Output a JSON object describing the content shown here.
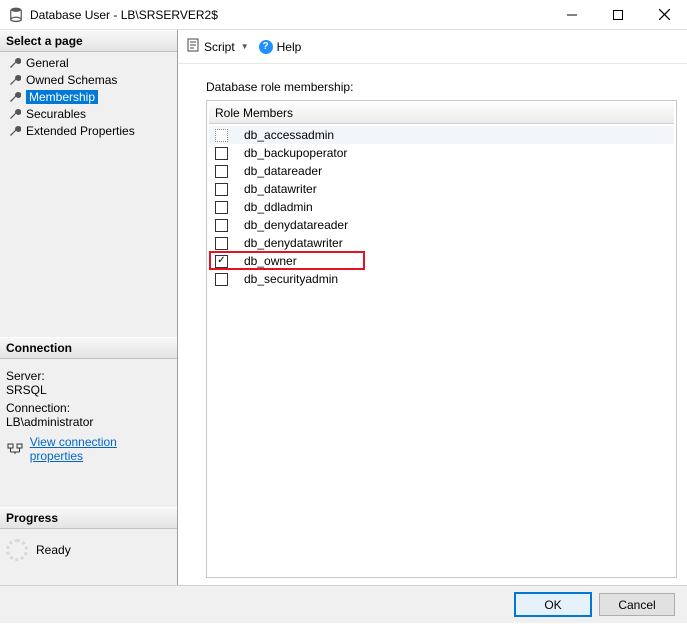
{
  "window": {
    "title": "Database User - LB\\SRSERVER2$"
  },
  "sidebar": {
    "select_page_header": "Select a page",
    "pages": [
      {
        "label": "General"
      },
      {
        "label": "Owned Schemas"
      },
      {
        "label": "Membership"
      },
      {
        "label": "Securables"
      },
      {
        "label": "Extended Properties"
      }
    ],
    "selected_index": 2,
    "connection_header": "Connection",
    "server_label": "Server:",
    "server_value": "SRSQL",
    "connection_label": "Connection:",
    "connection_value": "LB\\administrator",
    "view_conn_props": "View connection properties",
    "progress_header": "Progress",
    "progress_text": "Ready"
  },
  "toolbar": {
    "script_label": "Script",
    "help_label": "Help"
  },
  "content": {
    "group_label": "Database role membership:",
    "column_header": "Role Members",
    "roles": [
      {
        "name": "db_accessadmin",
        "checked": false
      },
      {
        "name": "db_backupoperator",
        "checked": false
      },
      {
        "name": "db_datareader",
        "checked": false
      },
      {
        "name": "db_datawriter",
        "checked": false
      },
      {
        "name": "db_ddladmin",
        "checked": false
      },
      {
        "name": "db_denydatareader",
        "checked": false
      },
      {
        "name": "db_denydatawriter",
        "checked": false
      },
      {
        "name": "db_owner",
        "checked": true
      },
      {
        "name": "db_securityadmin",
        "checked": false
      }
    ],
    "selected_role_index": 0,
    "highlighted_role_index": 7
  },
  "footer": {
    "ok": "OK",
    "cancel": "Cancel"
  }
}
